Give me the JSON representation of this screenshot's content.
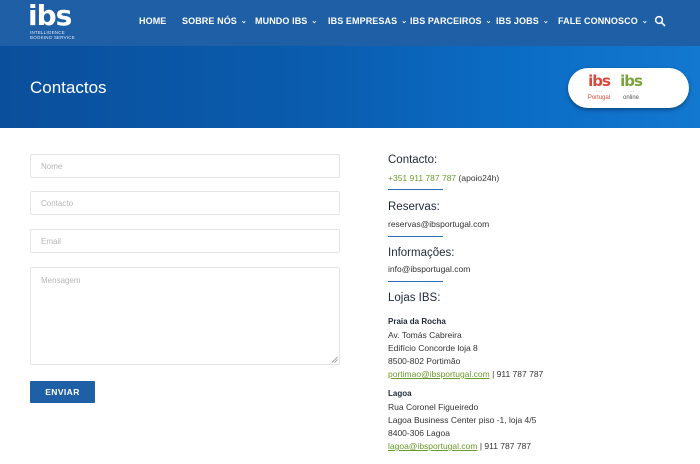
{
  "brand": {
    "logo_text": "ibs",
    "logo_sub_1": "INTELLIGENCE",
    "logo_sub_2": "BOOKING SERVICE"
  },
  "nav": {
    "items": [
      {
        "label": "HOME",
        "chevron": false
      },
      {
        "label": "SOBRE NÓS",
        "chevron": true
      },
      {
        "label": "MUNDO IBS",
        "chevron": true
      },
      {
        "label": "IBS EMPRESAS",
        "chevron": true
      },
      {
        "label": "IBS PARCEIROS",
        "chevron": true
      },
      {
        "label": "IBS JOBS",
        "chevron": true
      },
      {
        "label": "FALE CONNOSCO",
        "chevron": true
      }
    ],
    "search_icon": "search-icon"
  },
  "hero": {
    "title": "Contactos",
    "badge": {
      "left": {
        "text": "ibs",
        "tag": "Portugal"
      },
      "right": {
        "text": "ibs",
        "tag": "online"
      }
    }
  },
  "form": {
    "name_placeholder": "Nome",
    "contact_placeholder": "Contacto",
    "email_placeholder": "Email",
    "message_placeholder": "Mensagem",
    "submit_label": "ENVIAR"
  },
  "contact": {
    "contacto_heading": "Contacto:",
    "phone": "+351 911 787 787",
    "phone_note": "(apoio24h)",
    "reservas_heading": "Reservas:",
    "reservas_email": "reservas@ibsportugal.com",
    "info_heading": "Informações:",
    "info_email": "info@ibsportugal.com",
    "lojas_heading": "Lojas IBS:",
    "stores": [
      {
        "name": "Praia da Rocha",
        "address_1": "Av. Tomás Cabreira",
        "address_2": "Edifício Concorde loja 8",
        "address_3": "8500-802 Portimão",
        "email": "portimao@ibsportugal.com",
        "phone": "| 911 787 787"
      },
      {
        "name": "Lagoa",
        "address_1": "Rua Coronel Figueiredo",
        "address_2": "Lagoa Business Center piso -1, loja 4/5",
        "address_3": "8400-306 Lagoa",
        "email": "lagoa@ibsportugal.com",
        "phone": "| 911 787 787"
      }
    ]
  },
  "colors": {
    "nav_bg": "#1f5fa6",
    "hero_bg": "#0a5cae",
    "accent_green": "#6a9a2c",
    "ibs_red": "#d8473b",
    "ibs_green": "#7aa33a"
  }
}
